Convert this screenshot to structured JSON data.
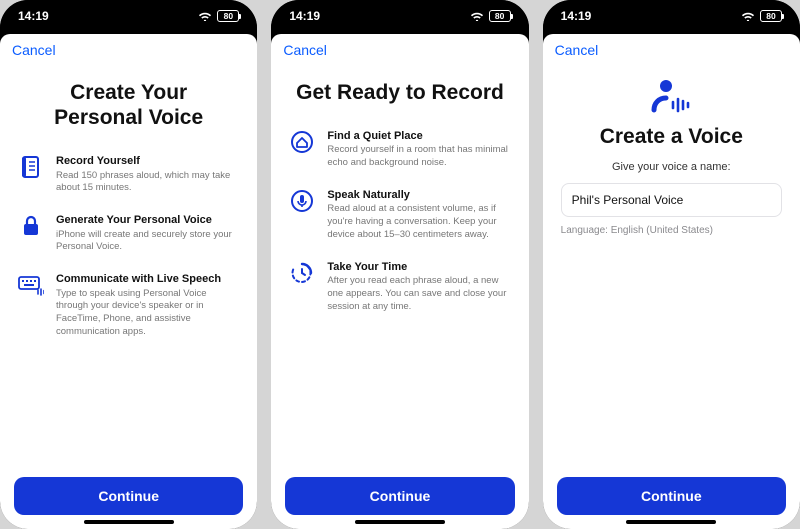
{
  "status": {
    "time": "14:19",
    "battery": "80"
  },
  "common": {
    "cancel": "Cancel",
    "continue": "Continue"
  },
  "screens": [
    {
      "title": "Create Your\nPersonal Voice",
      "items": [
        {
          "icon": "book-icon",
          "title": "Record Yourself",
          "desc": "Read 150 phrases aloud, which may take about 15 minutes."
        },
        {
          "icon": "lock-icon",
          "title": "Generate Your Personal Voice",
          "desc": "iPhone will create and securely store your Personal Voice."
        },
        {
          "icon": "keyboard-icon",
          "title": "Communicate with Live Speech",
          "desc": "Type to speak using Personal Voice through your device's speaker or in FaceTime, Phone, and assistive communication apps."
        }
      ]
    },
    {
      "title": "Get Ready to Record",
      "items": [
        {
          "icon": "home-icon",
          "title": "Find a Quiet Place",
          "desc": "Record yourself in a room that has minimal echo and background noise."
        },
        {
          "icon": "mic-icon",
          "title": "Speak Naturally",
          "desc": "Read aloud at a consistent volume, as if you're having a conversation. Keep your device about 15–30 centimeters away."
        },
        {
          "icon": "clock-icon",
          "title": "Take Your Time",
          "desc": "After you read each phrase aloud, a new one appears. You can save and close your session at any time."
        }
      ]
    },
    {
      "title": "Create a Voice",
      "prompt": "Give your voice a name:",
      "name_value": "Phil's Personal Voice",
      "language_label": "Language: English (United States)"
    }
  ]
}
